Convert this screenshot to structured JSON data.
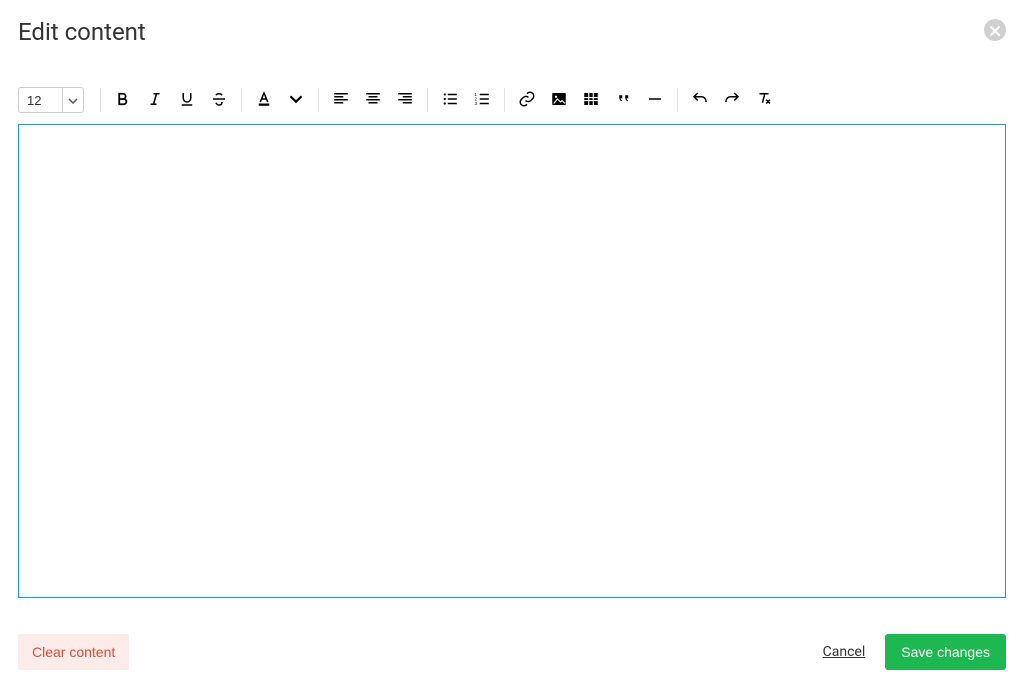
{
  "modal": {
    "title": "Edit content"
  },
  "toolbar": {
    "fontSize": "12"
  },
  "editor": {
    "content": ""
  },
  "footer": {
    "clear_label": "Clear content",
    "cancel_label": "Cancel",
    "save_label": "Save changes"
  },
  "colors": {
    "primary": "#1eb851",
    "danger": "#e34a36",
    "focus": "#0d99ff"
  }
}
